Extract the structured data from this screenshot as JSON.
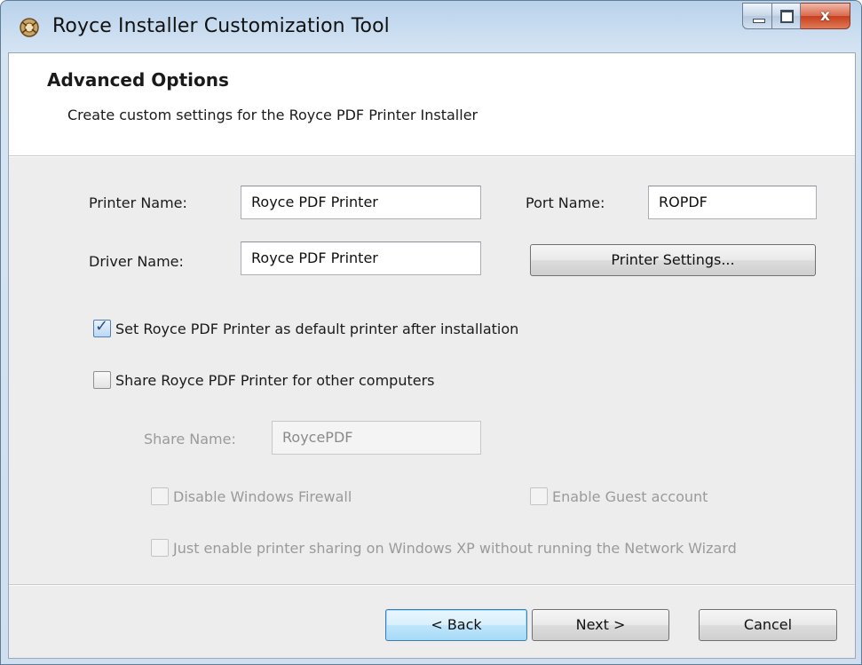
{
  "window": {
    "title": "Royce Installer Customization Tool",
    "minimize_icon": "minimize-icon",
    "maximize_icon": "maximize-icon",
    "close_icon": "close-icon",
    "close_glyph": "x"
  },
  "header": {
    "title": "Advanced Options",
    "subtitle": "Create custom settings for the Royce PDF Printer Installer"
  },
  "form": {
    "printer_name_label": "Printer Name:",
    "printer_name_value": "Royce PDF Printer",
    "port_name_label": "Port Name:",
    "port_name_value": "ROPDF",
    "driver_name_label": "Driver Name:",
    "driver_name_value": "Royce PDF Printer",
    "printer_settings_button": "Printer Settings...",
    "set_default_label": "Set Royce PDF Printer as default printer after installation",
    "set_default_checked": true,
    "share_label": "Share Royce PDF Printer for other computers",
    "share_checked": false,
    "share_name_label": "Share Name:",
    "share_name_value": "RoycePDF",
    "disable_firewall_label": "Disable Windows Firewall",
    "enable_guest_label": "Enable Guest account",
    "xp_sharing_label": "Just enable printer sharing on Windows XP without running the Network Wizard"
  },
  "footer": {
    "back_button": "< Back",
    "next_button": "Next >",
    "cancel_button": "Cancel"
  }
}
